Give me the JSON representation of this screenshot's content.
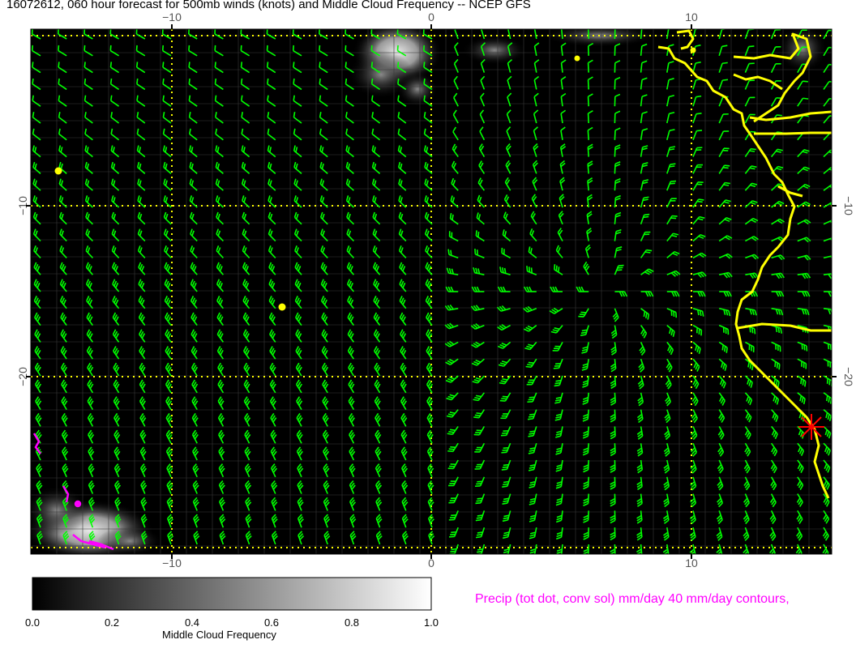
{
  "title": "16072612, 060 hour forecast for 500mb winds (knots) and Middle Cloud Frequency -- NCEP GFS",
  "map": {
    "lon_ticks_top": [
      "−10",
      "0",
      "10"
    ],
    "lon_ticks_bottom": [
      "−10",
      "0",
      "10"
    ],
    "lat_ticks_left": [
      "−10",
      "−20"
    ],
    "lat_ticks_right": [
      "−10",
      "−20"
    ],
    "colors": {
      "background": "#000000",
      "wind_barb": "#00ff00",
      "coastline": "#ffff00",
      "gridline": "#ffff00",
      "precip": "#ff00ff",
      "marker": "#ff0000"
    }
  },
  "colorbar": {
    "ticks": [
      "0.0",
      "0.2",
      "0.4",
      "0.6",
      "0.8",
      "1.0"
    ],
    "title": "Middle Cloud Frequency"
  },
  "precip_note": "Precip (tot dot, conv sol) mm/day 40 mm/day contours,"
}
